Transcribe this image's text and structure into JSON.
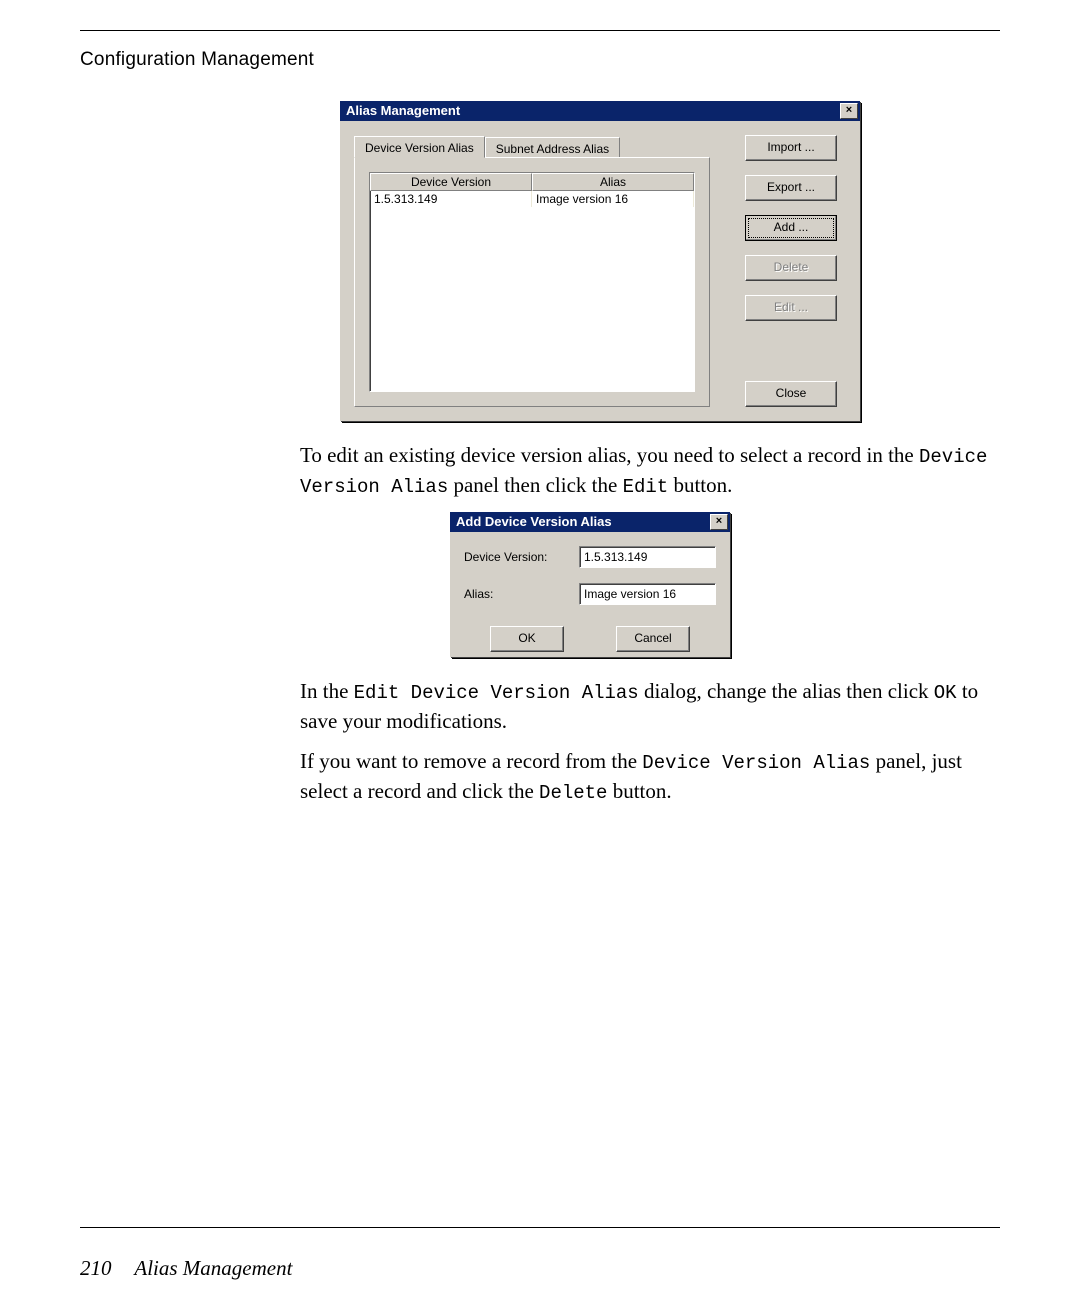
{
  "header": {
    "section_title": "Configuration Management"
  },
  "dialog1": {
    "title": "Alias Management",
    "tabs": [
      "Device Version Alias",
      "Subnet Address Alias"
    ],
    "columns": [
      "Device Version",
      "Alias"
    ],
    "rows": [
      {
        "version": "1.5.313.149",
        "alias": "Image version 16"
      }
    ],
    "buttons": {
      "import": "Import ...",
      "export": "Export ...",
      "add": "Add ...",
      "delete": "Delete",
      "edit": "Edit ...",
      "close": "Close"
    }
  },
  "para1": {
    "pre1": "To edit an existing device version alias, you need to select a record in the ",
    "code1": "Device Version Alias",
    "mid1": " panel then click the ",
    "code2": "Edit",
    "post1": " button."
  },
  "dialog2": {
    "title": "Add Device Version Alias",
    "labels": {
      "version": "Device Version:",
      "alias": "Alias:"
    },
    "values": {
      "version": "1.5.313.149",
      "alias": "Image version 16"
    },
    "buttons": {
      "ok": "OK",
      "cancel": "Cancel"
    }
  },
  "para2": {
    "pre1": "In the ",
    "code1": "Edit Device Version Alias",
    "mid1": " dialog, change the alias then click ",
    "code2": "OK",
    "post1": " to save your modifications."
  },
  "para3": {
    "pre1": "If you want to remove a record from the ",
    "code1": "Device Version Alias",
    "mid1": " panel, just select a record and click the ",
    "code2": "Delete",
    "post1": " button."
  },
  "footer": {
    "page": "210",
    "title": "Alias Management"
  }
}
